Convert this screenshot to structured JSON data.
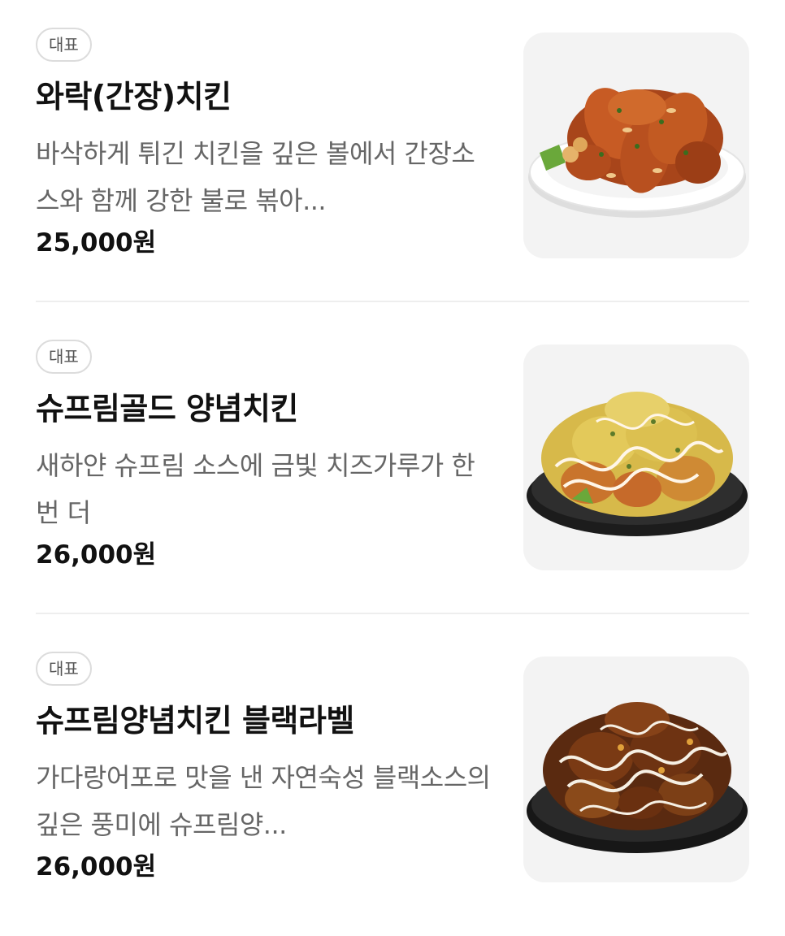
{
  "menu": {
    "items": [
      {
        "badge": "대표",
        "name": "와락(간장)치킨",
        "description": "바삭하게 튀긴 치킨을 깊은 볼에서 간장소스와 함께 강한 불로 볶아...",
        "price": "25,000원",
        "image": "soy-chicken-plate-icon"
      },
      {
        "badge": "대표",
        "name": "슈프림골드 양념치킨",
        "description": "새하얀 슈프림 소스에 금빛 치즈가루가 한 번 더",
        "price": "26,000원",
        "image": "supreme-gold-chicken-plate-icon"
      },
      {
        "badge": "대표",
        "name": "슈프림양념치킨 블랙라벨",
        "description": "가다랑어포로 맛을 낸 자연숙성 블랙소스의 깊은 풍미에 슈프림양...",
        "price": "26,000원",
        "image": "black-label-chicken-plate-icon"
      }
    ]
  }
}
